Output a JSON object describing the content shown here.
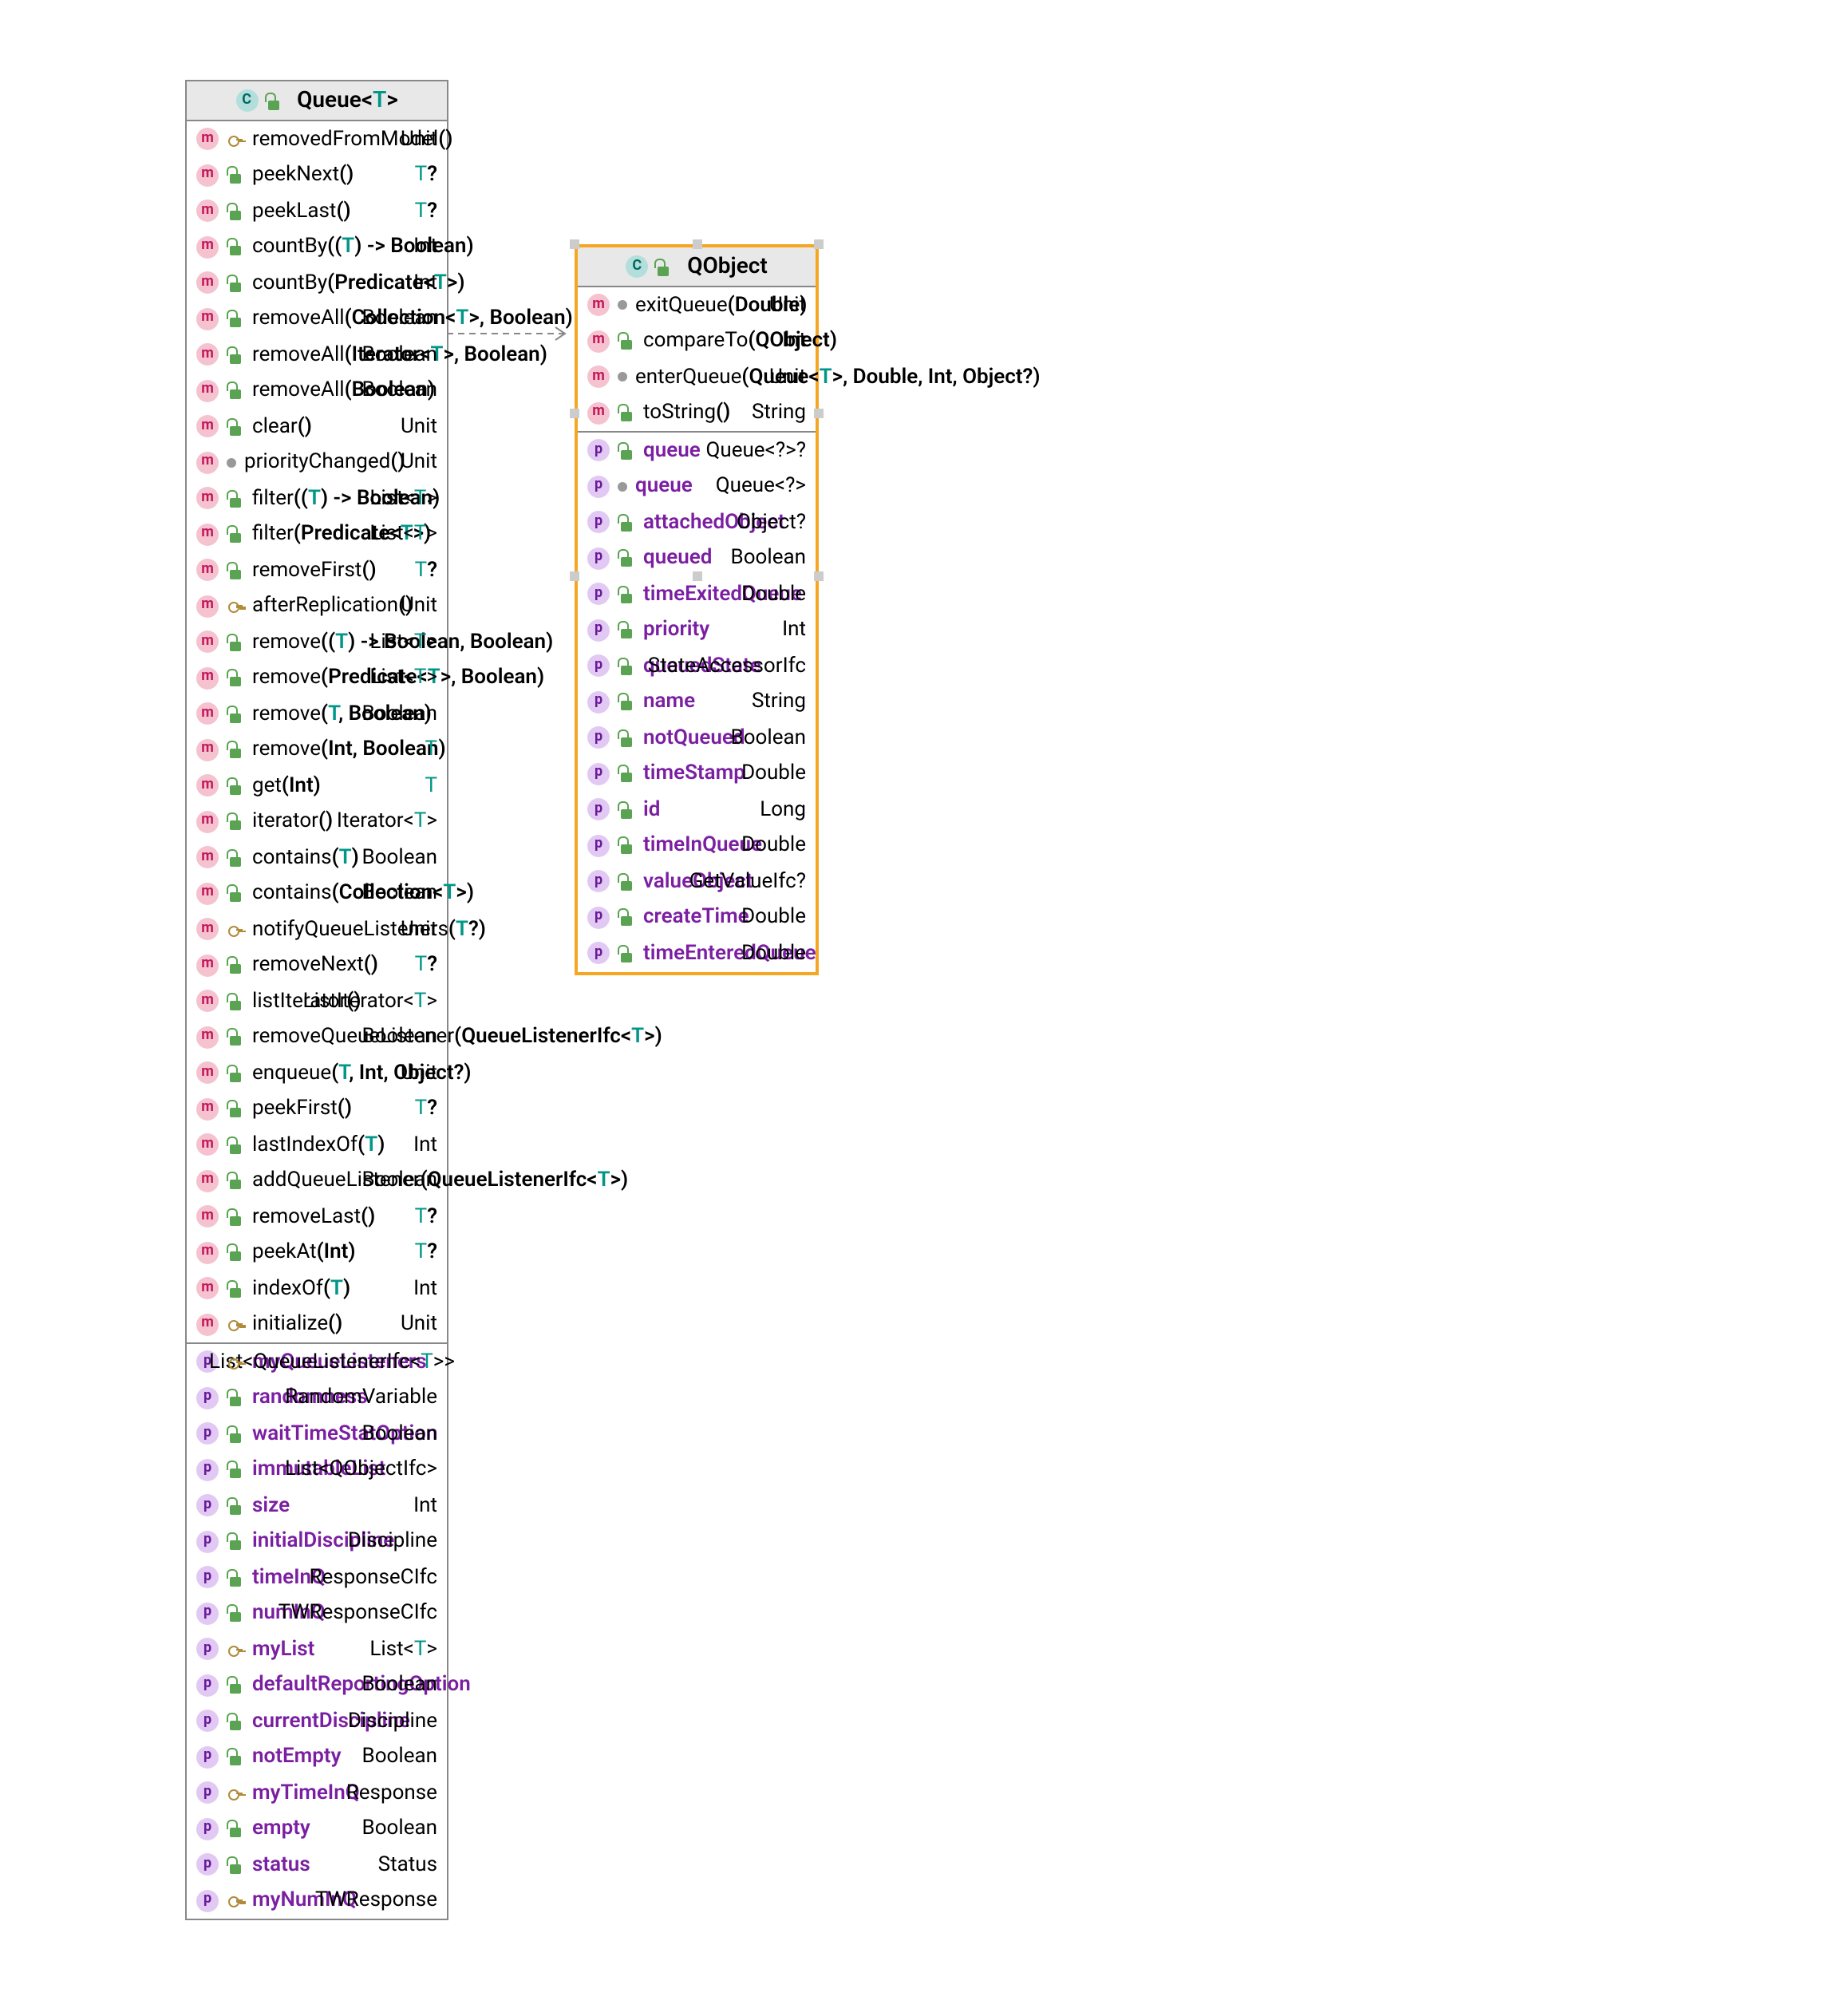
{
  "queue": {
    "title_prefix": "Queue",
    "lt": "<",
    "t": "T",
    "gt": ">",
    "methods": [
      {
        "name": "removedFromModel",
        "params": "()",
        "ret": "Unit",
        "mod": "key"
      },
      {
        "name": "peekNext",
        "params": "()",
        "ret": [
          "T",
          "?"
        ],
        "mod": "lock"
      },
      {
        "name": "peekLast",
        "params": "()",
        "ret": [
          "T",
          "?"
        ],
        "mod": "lock"
      },
      {
        "name": "countBy",
        "params": [
          "((",
          "T",
          ") -> Boolean)"
        ],
        "ret": "Int",
        "mod": "lock"
      },
      {
        "name": "countBy",
        "params": [
          "(Predicate<",
          "T",
          ">)"
        ],
        "ret": "Int",
        "mod": "lock"
      },
      {
        "name": "removeAll",
        "params": [
          "(Collection<",
          "T",
          ">, Boolean)"
        ],
        "ret": "Boolean",
        "mod": "lock"
      },
      {
        "name": "removeAll",
        "params": [
          "(Iterator<",
          "T",
          ">, Boolean)"
        ],
        "ret": "Boolean",
        "mod": "lock"
      },
      {
        "name": "removeAll",
        "params": "(Boolean)",
        "ret": "Boolean",
        "mod": "lock"
      },
      {
        "name": "clear",
        "params": "()",
        "ret": "Unit",
        "mod": "lock"
      },
      {
        "name": "priorityChanged",
        "params": "()",
        "ret": "Unit",
        "mod": "dot"
      },
      {
        "name": "filter",
        "params": [
          "((",
          "T",
          ") -> Boolean)"
        ],
        "ret": [
          "List<",
          "T",
          ">"
        ],
        "mod": "lock"
      },
      {
        "name": "filter",
        "params": [
          "(Predicate<",
          "T",
          ">)"
        ],
        "ret": [
          "List<",
          "T",
          ">"
        ],
        "mod": "lock"
      },
      {
        "name": "removeFirst",
        "params": "()",
        "ret": [
          "T",
          "?"
        ],
        "mod": "lock"
      },
      {
        "name": "afterReplication",
        "params": "()",
        "ret": "Unit",
        "mod": "key"
      },
      {
        "name": "remove",
        "params": [
          "((",
          "T",
          ") -> Boolean, Boolean)"
        ],
        "ret": [
          "List<",
          "T",
          ">"
        ],
        "mod": "lock"
      },
      {
        "name": "remove",
        "params": [
          "(Predicate<",
          "T",
          ">, Boolean)"
        ],
        "ret": [
          "List<",
          "T",
          ">"
        ],
        "mod": "lock"
      },
      {
        "name": "remove",
        "params": [
          "(",
          "T",
          ", Boolean)"
        ],
        "ret": "Boolean",
        "mod": "lock"
      },
      {
        "name": "remove",
        "params": "(Int, Boolean)",
        "ret": [
          "T"
        ],
        "mod": "lock"
      },
      {
        "name": "get",
        "params": "(Int)",
        "ret": [
          "T"
        ],
        "mod": "lock"
      },
      {
        "name": "iterator",
        "params": "()",
        "ret": [
          "Iterator<",
          "T",
          ">"
        ],
        "mod": "lock"
      },
      {
        "name": "contains",
        "params": [
          "(",
          "T",
          ")"
        ],
        "ret": "Boolean",
        "mod": "lock"
      },
      {
        "name": "contains",
        "params": [
          "(Collection<",
          "T",
          ">)"
        ],
        "ret": "Boolean",
        "mod": "lock"
      },
      {
        "name": "notifyQueueListeners",
        "params": [
          "(",
          "T",
          "?)"
        ],
        "ret": "Unit",
        "mod": "key"
      },
      {
        "name": "removeNext",
        "params": "()",
        "ret": [
          "T",
          "?"
        ],
        "mod": "lock"
      },
      {
        "name": "listIterator",
        "params": "()",
        "ret": [
          "ListIterator<",
          "T",
          ">"
        ],
        "mod": "lock"
      },
      {
        "name": "removeQueueListener",
        "params": [
          "(QueueListenerIfc<",
          "T",
          ">)"
        ],
        "ret": "Boolean",
        "mod": "lock"
      },
      {
        "name": "enqueue",
        "params": [
          "(",
          "T",
          ", Int, Object?)"
        ],
        "ret": "Unit",
        "mod": "lock"
      },
      {
        "name": "peekFirst",
        "params": "()",
        "ret": [
          "T",
          "?"
        ],
        "mod": "lock"
      },
      {
        "name": "lastIndexOf",
        "params": [
          "(",
          "T",
          ")"
        ],
        "ret": "Int",
        "mod": "lock"
      },
      {
        "name": "addQueueListener",
        "params": [
          "(QueueListenerIfc<",
          "T",
          ">)"
        ],
        "ret": "Boolean",
        "mod": "lock"
      },
      {
        "name": "removeLast",
        "params": "()",
        "ret": [
          "T",
          "?"
        ],
        "mod": "lock"
      },
      {
        "name": "peekAt",
        "params": "(Int)",
        "ret": [
          "T",
          "?"
        ],
        "mod": "lock"
      },
      {
        "name": "indexOf",
        "params": [
          "(",
          "T",
          ")"
        ],
        "ret": "Int",
        "mod": "lock"
      },
      {
        "name": "initialize",
        "params": "()",
        "ret": "Unit",
        "mod": "key"
      }
    ],
    "props": [
      {
        "name": "myQueueListeners",
        "ret": [
          "List<QueueListenerIfc<",
          "T",
          ">>"
        ],
        "mod": "key"
      },
      {
        "name": "randomness",
        "ret": "RandomVariable",
        "mod": "lock"
      },
      {
        "name": "waitTimeStatOption",
        "ret": "Boolean",
        "mod": "lock"
      },
      {
        "name": "immutableList",
        "ret": "List<QObjectIfc>",
        "mod": "lock"
      },
      {
        "name": "size",
        "ret": "Int",
        "mod": "lock"
      },
      {
        "name": "initialDiscipline",
        "ret": "Discipline",
        "mod": "lock"
      },
      {
        "name": "timeInQ",
        "ret": "ResponseCIfc",
        "mod": "lock"
      },
      {
        "name": "numInQ",
        "ret": "TWResponseCIfc",
        "mod": "lock"
      },
      {
        "name": "myList",
        "ret": [
          "List<",
          "T",
          ">"
        ],
        "mod": "key"
      },
      {
        "name": "defaultReportingOption",
        "ret": "Boolean",
        "mod": "lock"
      },
      {
        "name": "currentDiscipline",
        "ret": "Discipline",
        "mod": "lock"
      },
      {
        "name": "notEmpty",
        "ret": "Boolean",
        "mod": "lock"
      },
      {
        "name": "myTimeInQ",
        "ret": "Response",
        "mod": "key"
      },
      {
        "name": "empty",
        "ret": "Boolean",
        "mod": "lock"
      },
      {
        "name": "status",
        "ret": "Status",
        "mod": "lock"
      },
      {
        "name": "myNumInQ",
        "ret": "TWResponse",
        "mod": "key"
      }
    ]
  },
  "qobject": {
    "title": "QObject",
    "methods": [
      {
        "name": "exitQueue",
        "params": "(Double)",
        "ret": "Unit",
        "mod": "dot"
      },
      {
        "name": "compareTo",
        "params": "(QObject)",
        "ret": "Int",
        "mod": "lock"
      },
      {
        "name": "enterQueue",
        "params": [
          "(Queue<",
          "T",
          ">, Double, Int, Object?)"
        ],
        "ret": "Unit",
        "mod": "dot"
      },
      {
        "name": "toString",
        "params": "()",
        "ret": "String",
        "mod": "lock"
      }
    ],
    "props": [
      {
        "name": "queue",
        "ret": "Queue<?>?",
        "mod": "lock"
      },
      {
        "name": "queue",
        "ret": "Queue<?>",
        "mod": "dot"
      },
      {
        "name": "attachedObject",
        "ret": "Object?",
        "mod": "lock"
      },
      {
        "name": "queued",
        "ret": "Boolean",
        "mod": "lock"
      },
      {
        "name": "timeExitedQueue",
        "ret": "Double",
        "mod": "lock"
      },
      {
        "name": "priority",
        "ret": "Int",
        "mod": "lock"
      },
      {
        "name": "queuedState",
        "ret": "StateAccessorIfc",
        "mod": "lock"
      },
      {
        "name": "name",
        "ret": "String",
        "mod": "lock"
      },
      {
        "name": "notQueued",
        "ret": "Boolean",
        "mod": "lock"
      },
      {
        "name": "timeStamp",
        "ret": "Double",
        "mod": "lock"
      },
      {
        "name": "id",
        "ret": "Long",
        "mod": "lock"
      },
      {
        "name": "timeInQueue",
        "ret": "Double",
        "mod": "lock"
      },
      {
        "name": "valueObject",
        "ret": "GetValueIfc?",
        "mod": "lock"
      },
      {
        "name": "createTime",
        "ret": "Double",
        "mod": "lock"
      },
      {
        "name": "timeEnteredQueue",
        "ret": "Double",
        "mod": "lock"
      }
    ]
  }
}
